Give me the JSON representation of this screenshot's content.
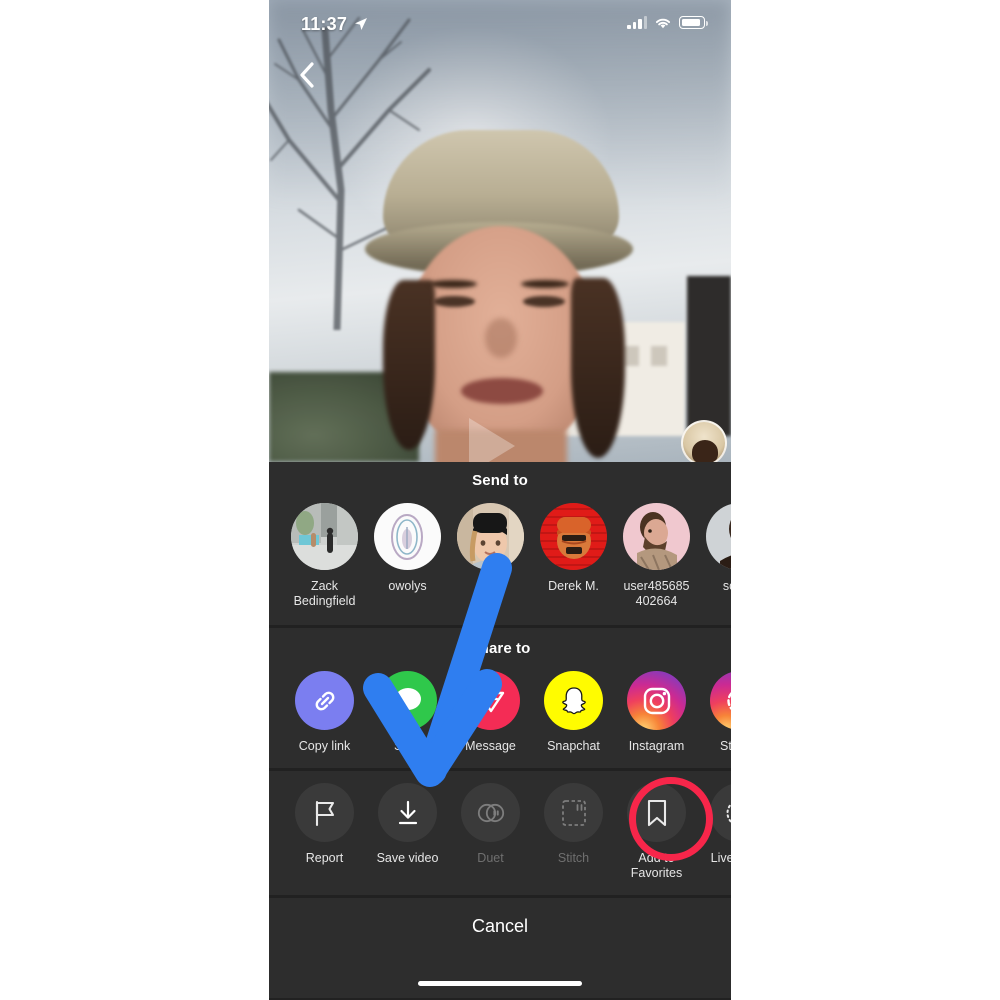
{
  "status_bar": {
    "time": "11:37",
    "location_icon": "location-arrow-icon",
    "signal_icon": "cellular-signal-icon",
    "wifi_icon": "wifi-icon",
    "battery_icon": "battery-icon"
  },
  "video": {
    "back_icon": "chevron-left-icon",
    "play_icon": "play-triangle-icon"
  },
  "send_to": {
    "title": "Send to",
    "contacts": [
      {
        "name": "Zack Bedingfield",
        "avatar": "street-photo-avatar"
      },
      {
        "name": "owolys",
        "avatar": "white-abstract-avatar"
      },
      {
        "name": "",
        "avatar": "beanie-person-avatar"
      },
      {
        "name": "Derek M.",
        "avatar": "red-cartoon-avatar"
      },
      {
        "name": "user485685402664",
        "avatar": "pink-bearded-man-avatar"
      },
      {
        "name": "scott_",
        "avatar": "dark-portrait-avatar"
      }
    ]
  },
  "share_to": {
    "title": "Share to",
    "options": [
      {
        "label": "Copy link",
        "icon": "link-icon"
      },
      {
        "label": "SMS",
        "icon": "sms-bubble-icon"
      },
      {
        "label": "Message",
        "icon": "direct-message-icon"
      },
      {
        "label": "Snapchat",
        "icon": "snapchat-ghost-icon"
      },
      {
        "label": "Instagram",
        "icon": "instagram-camera-icon"
      },
      {
        "label": "Stories",
        "icon": "instagram-stories-icon"
      }
    ]
  },
  "actions": {
    "items": [
      {
        "label": "Report",
        "icon": "flag-icon",
        "disabled": false
      },
      {
        "label": "Save video",
        "icon": "download-icon",
        "disabled": false
      },
      {
        "label": "Duet",
        "icon": "duet-circles-icon",
        "disabled": true
      },
      {
        "label": "Stitch",
        "icon": "stitch-icon",
        "disabled": true
      },
      {
        "label": "Add to Favorites",
        "icon": "bookmark-icon",
        "disabled": false
      },
      {
        "label": "Live photo",
        "icon": "live-photo-icon",
        "disabled": false
      }
    ]
  },
  "cancel": {
    "label": "Cancel"
  },
  "annotation": {
    "arrow_color": "#2f7ef0",
    "highlight_color": "#f7264a",
    "points_to": "Save video"
  }
}
